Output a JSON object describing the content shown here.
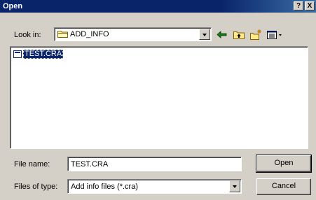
{
  "window": {
    "title": "Open",
    "help_label": "?",
    "close_label": "X"
  },
  "look_in": {
    "label": "Look in:",
    "value": "ADD_INFO"
  },
  "toolbar": {
    "icons": [
      "back-icon",
      "up-folder-icon",
      "new-folder-icon",
      "view-menu-icon"
    ]
  },
  "files": [
    {
      "name": "TEST.CRA",
      "selected": true
    }
  ],
  "file_name": {
    "label": "File name:",
    "value": "TEST.CRA"
  },
  "file_type": {
    "label": "Files of type:",
    "value": "Add info files (*.cra)"
  },
  "buttons": {
    "open": "Open",
    "cancel": "Cancel"
  },
  "colors": {
    "titlebar": "#0a246a",
    "face": "#d4d0c8",
    "selection": "#0a246a"
  }
}
